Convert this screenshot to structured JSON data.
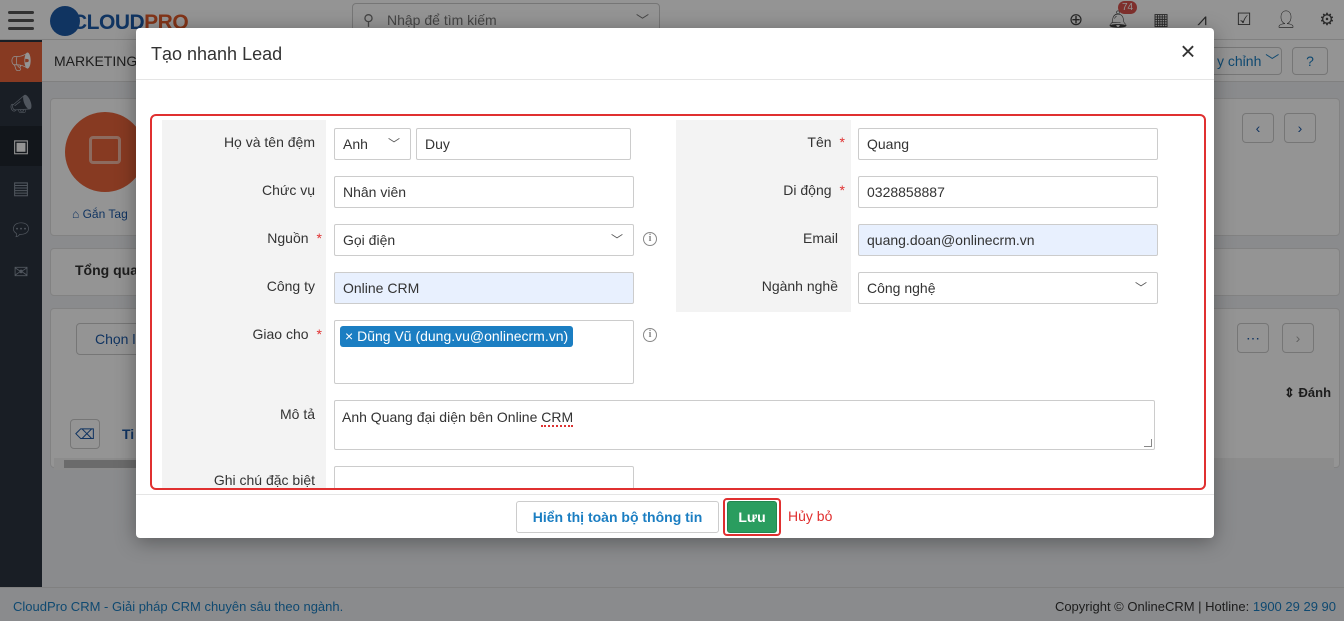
{
  "topbar": {
    "logo_text": "CLOUDPRO",
    "search_placeholder": "Nhập để tìm kiếm",
    "notification_count": "74"
  },
  "page": {
    "module_title": "MARKETING",
    "customize_label": "y chỉnh",
    "tag_link": "Gắn Tag",
    "overview_label": "Tổng qua",
    "choose_label": "Chọn l",
    "sort_label": "Đánh",
    "ti_label": "Ti"
  },
  "modal": {
    "title": "Tạo nhanh Lead",
    "fields": {
      "middle_name_label": "Họ và tên đệm",
      "salutation_value": "Anh",
      "middle_name_value": "Duy",
      "first_name_label": "Tên",
      "first_name_value": "Quang",
      "title_label": "Chức vụ",
      "title_value": "Nhân viên",
      "mobile_label": "Di động",
      "mobile_value": "0328858887",
      "source_label": "Nguồn",
      "source_value": "Gọi điện",
      "email_label": "Email",
      "email_value": "quang.doan@onlinecrm.vn",
      "company_label": "Công ty",
      "company_value": "Online CRM",
      "industry_label": "Ngành nghề",
      "industry_value": "Công nghệ",
      "assignee_label": "Giao cho",
      "assignee_value": "Dũng Vũ (dung.vu@onlinecrm.vn)",
      "description_label": "Mô tả",
      "description_value_prefix": "Anh Quang đại diện bên Online ",
      "description_value_flagged": "CRM",
      "notes_label": "Ghi chú đặc biệt"
    },
    "buttons": {
      "show_all": "Hiển thị toàn bộ thông tin",
      "save": "Lưu",
      "cancel": "Hủy bỏ"
    }
  },
  "footer": {
    "left_text": "CloudPro CRM - Giải pháp CRM chuyên sâu theo ngành.",
    "right_prefix": "Copyright © OnlineCRM | Hotline: ",
    "hotline": "1900 29 29 90"
  },
  "colors": {
    "accent": "#1b7ec2",
    "save": "#2a9d5f",
    "highlight_border": "#e03030",
    "marketing": "#e8643c"
  }
}
